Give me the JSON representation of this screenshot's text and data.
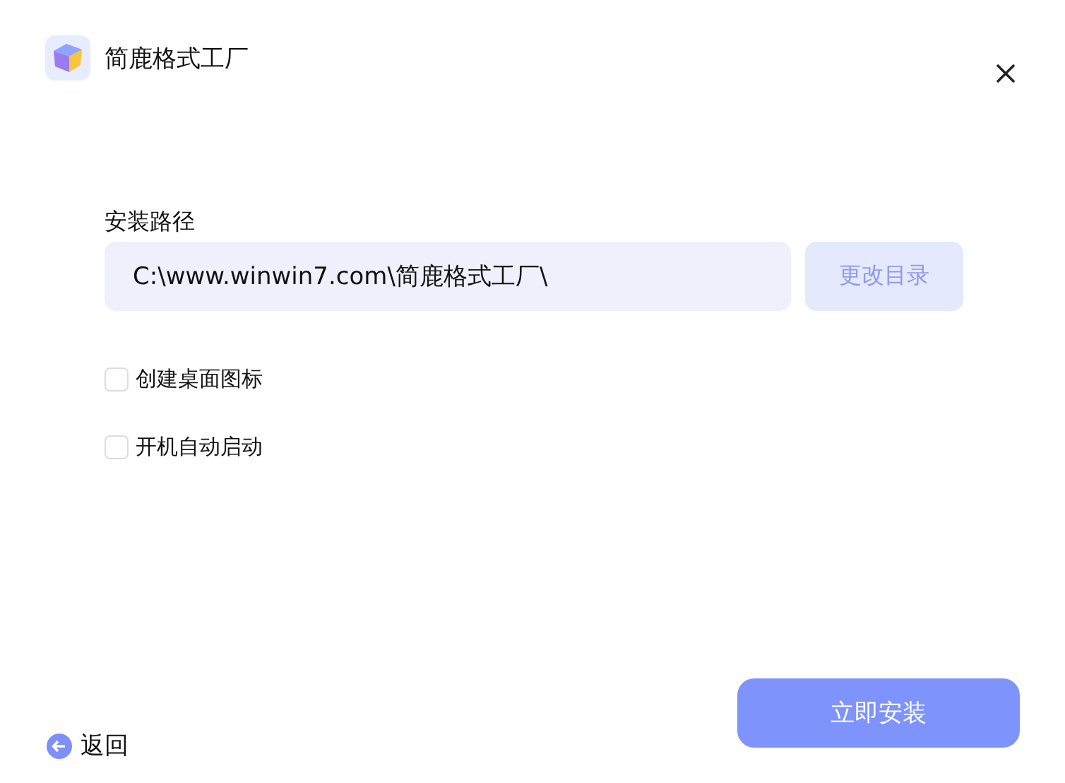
{
  "window": {
    "title": "简鹿格式工厂"
  },
  "path": {
    "label": "安装路径",
    "value": "C:\\www.winwin7.com\\简鹿格式工厂\\",
    "change_button": "更改目录"
  },
  "options": [
    {
      "label": "创建桌面图标",
      "checked": false
    },
    {
      "label": "开机自动启动",
      "checked": false
    }
  ],
  "back": "返回",
  "install_button": "立即安装"
}
